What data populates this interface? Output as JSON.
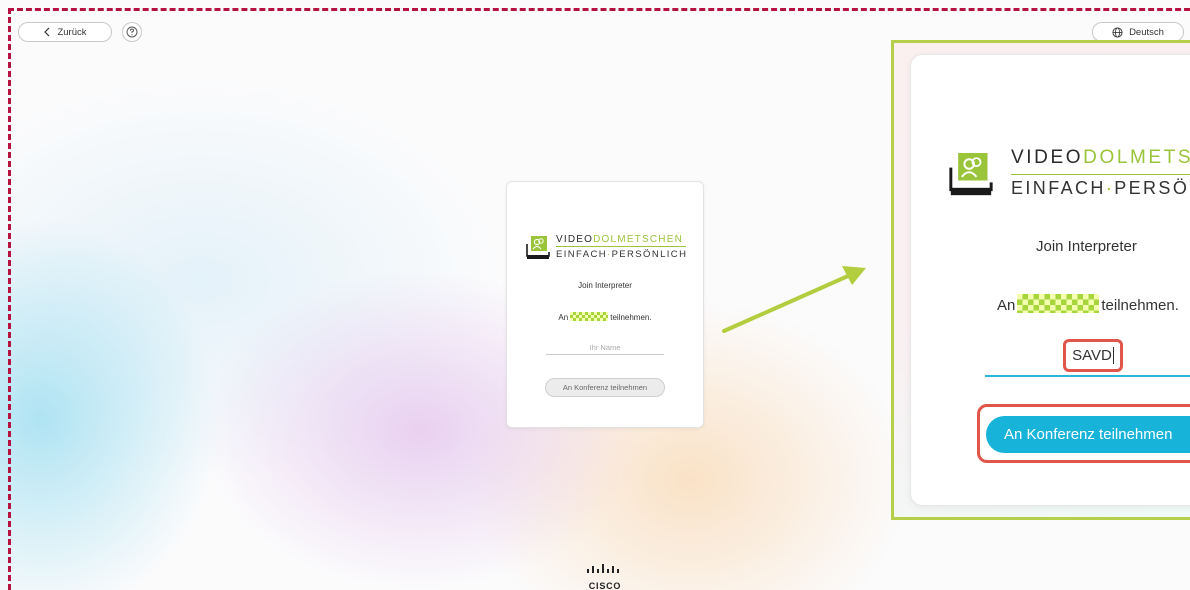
{
  "toolbar": {
    "back_label": "Zurück",
    "back_icon": "chevron-left-icon",
    "help_icon": "question-circle-icon",
    "lang_label": "Deutsch",
    "lang_icon": "globe-icon"
  },
  "logo": {
    "word_video": "VIDEO",
    "word_dolmetschen": "DOLMETSCHEN",
    "word_einfach": "EINFACH",
    "separator": "·",
    "word_persoenlich": "PERSÖNLICH",
    "brand_green": "#9ac43a"
  },
  "join_card": {
    "heading": "Join Interpreter",
    "an_prefix": "An",
    "an_suffix": "teilnehmen.",
    "name_placeholder": "Ihr Name",
    "join_button": "An Konferenz teilnehmen"
  },
  "zoom": {
    "logo_video": "VIDEO",
    "logo_dolmetschen": "DOLMETSC",
    "logo_einfach": "EINFACH",
    "logo_separator": "·",
    "logo_persoenlich": "PERSÖN",
    "heading": "Join Interpreter",
    "an_prefix": "An",
    "an_suffix": "teilnehmen.",
    "name_value": "SAVD",
    "join_button": "An Konferenz teilnehmen",
    "button_color": "#17b3d9",
    "highlight_color": "#e0564a"
  },
  "footer": {
    "brand": "CISCO"
  }
}
